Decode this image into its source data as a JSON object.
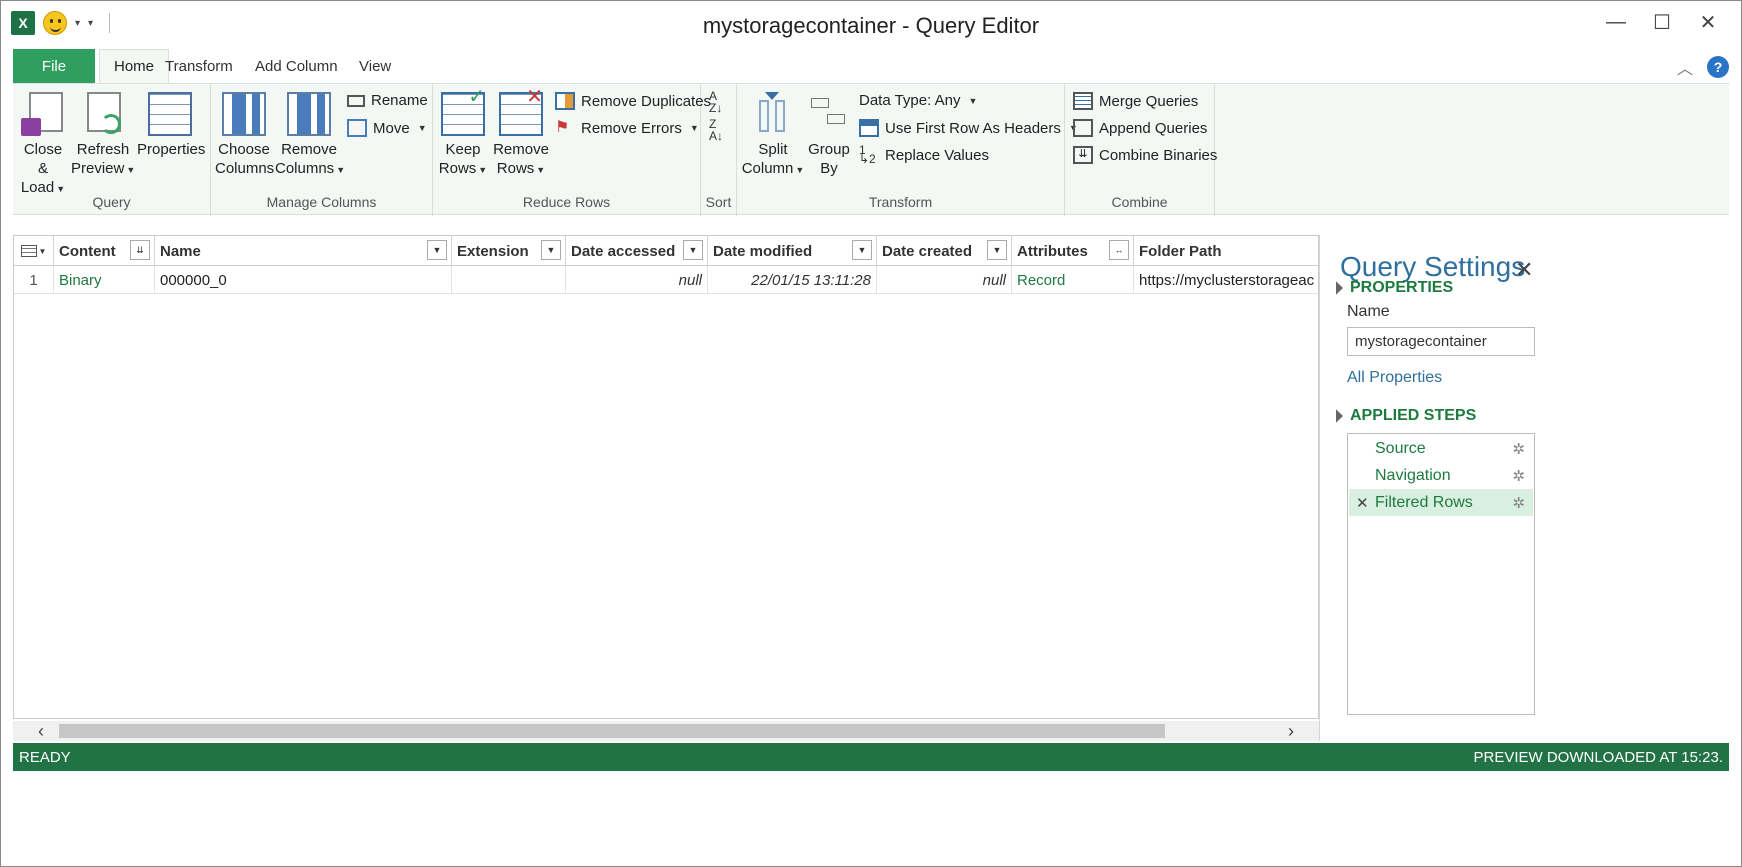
{
  "window": {
    "title": "mystoragecontainer - Query Editor"
  },
  "tabs": {
    "file": "File",
    "items": [
      "Home",
      "Transform",
      "Add Column",
      "View"
    ]
  },
  "ribbon": {
    "query": {
      "label": "Query",
      "close_load": [
        "Close &",
        "Load"
      ],
      "refresh": [
        "Refresh",
        "Preview"
      ],
      "properties": "Properties"
    },
    "manage": {
      "label": "Manage Columns",
      "choose": [
        "Choose",
        "Columns"
      ],
      "remove": [
        "Remove",
        "Columns"
      ],
      "rename": "Rename",
      "move": "Move"
    },
    "reduce": {
      "label": "Reduce Rows",
      "keep": [
        "Keep",
        "Rows"
      ],
      "remove": [
        "Remove",
        "Rows"
      ],
      "remove_duplicates": "Remove Duplicates",
      "remove_errors": "Remove Errors"
    },
    "sort": {
      "label": "Sort"
    },
    "transform": {
      "label": "Transform",
      "split": [
        "Split",
        "Column"
      ],
      "group": [
        "Group",
        "By"
      ],
      "data_type": "Data Type: Any",
      "first_row": "Use First Row As Headers",
      "replace": "Replace Values"
    },
    "combine": {
      "label": "Combine",
      "merge": "Merge Queries",
      "append": "Append Queries",
      "binaries": "Combine Binaries"
    }
  },
  "grid": {
    "columns": [
      "Content",
      "Name",
      "Extension",
      "Date accessed",
      "Date modified",
      "Date created",
      "Attributes",
      "Folder Path"
    ],
    "row": {
      "index": "1",
      "content": "Binary",
      "name": "000000_0",
      "extension": "",
      "date_accessed": "null",
      "date_modified": "22/01/15 13:11:28",
      "date_created": "null",
      "attributes": "Record",
      "folder_path": "https://myclusterstorageac"
    }
  },
  "query_settings": {
    "title": "Query Settings",
    "properties_header": "PROPERTIES",
    "name_label": "Name",
    "name_value": "mystoragecontainer",
    "all_properties": "All Properties",
    "applied_steps_header": "APPLIED STEPS",
    "steps": [
      "Source",
      "Navigation",
      "Filtered Rows"
    ]
  },
  "status": {
    "left": "READY",
    "right": "PREVIEW DOWNLOADED AT 15:23."
  },
  "colors": {
    "accent": "#217346",
    "file_tab": "#2f9e5f",
    "link": "#2e6f9e"
  }
}
